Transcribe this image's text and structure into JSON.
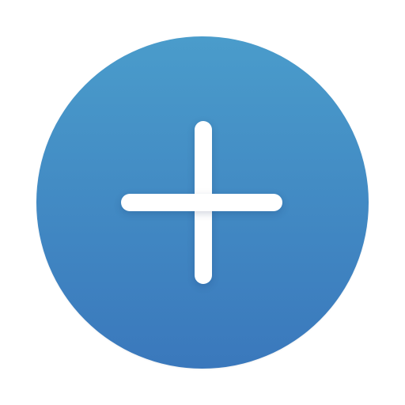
{
  "add_button": {
    "icon": "plus-icon",
    "colors": {
      "gradient_top": "#4a9ccb",
      "gradient_bottom": "#3a78bc",
      "glyph": "#ffffff"
    }
  }
}
